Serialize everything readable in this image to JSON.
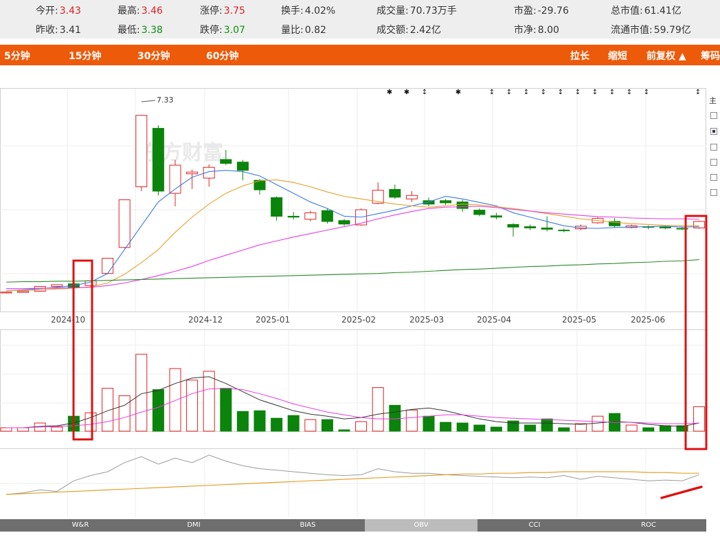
{
  "quote": {
    "row1": [
      {
        "label": "今开:",
        "value": "3.43",
        "color": "red"
      },
      {
        "label": "最高:",
        "value": "3.46",
        "color": "red"
      },
      {
        "label": "涨停:",
        "value": "3.75",
        "color": "red"
      },
      {
        "label": "换手:",
        "value": "4.02%",
        "color": "dark"
      },
      {
        "label": "成交量:",
        "value": "70.73万手",
        "color": "dark"
      },
      {
        "label": "市盈:",
        "value": "-29.76",
        "color": "dark"
      },
      {
        "label": "总市值:",
        "value": "61.41亿",
        "color": "dark"
      }
    ],
    "row2": [
      {
        "label": "昨收:",
        "value": "3.41",
        "color": "dark"
      },
      {
        "label": "最低:",
        "value": "3.38",
        "color": "green"
      },
      {
        "label": "跌停:",
        "value": "3.07",
        "color": "green"
      },
      {
        "label": "量比:",
        "value": "0.82",
        "color": "dark"
      },
      {
        "label": "成交额:",
        "value": "2.42亿",
        "color": "dark"
      },
      {
        "label": "市净:",
        "value": "8.00",
        "color": "dark"
      },
      {
        "label": "流通市值:",
        "value": "59.79亿",
        "color": "dark"
      }
    ]
  },
  "periods": [
    "5分钟",
    "15分钟",
    "30分钟",
    "60分钟"
  ],
  "toolbar": {
    "stretch": "拉长",
    "shrink": "缩短",
    "adjust": "前复权 ▲",
    "chip": "筹码"
  },
  "side_label": "主",
  "watermark": "东方财富",
  "max_price_label": "7.33",
  "x_axis_labels": [
    "2024-10",
    "2024-12",
    "2025-01",
    "2025-02",
    "2025-03",
    "2025-04",
    "2025-05",
    "2025-06"
  ],
  "indicator_tabs": [
    "W&R",
    "DMI",
    "BIAS",
    "OBV",
    "CCI",
    "ROC"
  ],
  "active_tab": "OBV",
  "colors": {
    "up": "#e02020",
    "down": "#0a840a",
    "accent": "#ec5a0a",
    "ma5": "#3b78e7",
    "ma10": "#e3a12c",
    "ma20": "#e83ce0",
    "ma60": "#2a8a2a",
    "highlight": "#dd1111"
  },
  "chart_data": {
    "type": "candlestick",
    "series": [
      {
        "name": "K线",
        "ohlc": [
          [
            2.75,
            2.77,
            2.74,
            2.76
          ],
          [
            2.76,
            2.79,
            2.75,
            2.78
          ],
          [
            2.79,
            2.9,
            2.78,
            2.89
          ],
          [
            2.9,
            2.94,
            2.88,
            2.93
          ],
          [
            2.96,
            2.88,
            2.86,
            2.98
          ],
          [
            2.92,
            3.03,
            2.9,
            3.01
          ],
          [
            3.2,
            3.55,
            3.18,
            3.52
          ],
          [
            3.8,
            4.9,
            3.78,
            4.82
          ],
          [
            5.2,
            6.85,
            5.1,
            6.55
          ],
          [
            6.55,
            5.1,
            5.0,
            6.62
          ],
          [
            5.05,
            5.7,
            4.75,
            5.82
          ],
          [
            5.5,
            5.54,
            5.15,
            5.6
          ],
          [
            5.4,
            5.65,
            5.2,
            5.72
          ],
          [
            5.83,
            5.74,
            5.7,
            6.05
          ],
          [
            5.77,
            5.58,
            5.35,
            5.82
          ],
          [
            5.35,
            5.13,
            5.02,
            5.38
          ],
          [
            4.95,
            4.52,
            4.42,
            4.98
          ],
          [
            4.52,
            4.5,
            4.44,
            4.62
          ],
          [
            4.45,
            4.6,
            4.4,
            4.65
          ],
          [
            4.65,
            4.4,
            4.35,
            4.7
          ],
          [
            4.42,
            4.34,
            4.3,
            4.46
          ],
          [
            4.32,
            4.67,
            4.3,
            4.7
          ],
          [
            4.82,
            5.12,
            4.8,
            5.3
          ],
          [
            5.14,
            4.96,
            4.92,
            5.25
          ],
          [
            4.92,
            5.0,
            4.85,
            5.1
          ],
          [
            4.88,
            4.8,
            4.75,
            4.95
          ],
          [
            4.88,
            4.83,
            4.78,
            4.92
          ],
          [
            4.85,
            4.7,
            4.62,
            4.9
          ],
          [
            4.66,
            4.56,
            4.52,
            4.7
          ],
          [
            4.53,
            4.5,
            4.45,
            4.6
          ],
          [
            4.33,
            4.27,
            4.05,
            4.36
          ],
          [
            4.28,
            4.25,
            4.2,
            4.33
          ],
          [
            4.25,
            4.22,
            4.17,
            4.52
          ],
          [
            4.2,
            4.19,
            4.15,
            4.24
          ],
          [
            4.23,
            4.29,
            4.2,
            4.33
          ],
          [
            4.37,
            4.47,
            4.35,
            4.5
          ],
          [
            4.4,
            4.3,
            4.25,
            4.48
          ],
          [
            4.26,
            4.3,
            4.24,
            4.33
          ],
          [
            4.28,
            4.27,
            4.22,
            4.31
          ],
          [
            4.27,
            4.25,
            4.22,
            4.3
          ],
          [
            4.24,
            4.23,
            4.2,
            4.27
          ],
          [
            4.25,
            4.4,
            4.23,
            4.42
          ]
        ]
      },
      {
        "name": "MA5",
        "values": [
          2.8,
          2.82,
          2.85,
          2.88,
          2.92,
          3.0,
          3.2,
          3.75,
          4.3,
          4.85,
          5.15,
          5.42,
          5.55,
          5.58,
          5.55,
          5.45,
          5.25,
          5.05,
          4.85,
          4.7,
          4.52,
          4.5,
          4.58,
          4.66,
          4.76,
          4.85,
          4.98,
          4.92,
          4.84,
          4.76,
          4.6,
          4.5,
          4.4,
          4.3,
          4.25,
          4.24,
          4.26,
          4.27,
          4.28,
          4.29,
          4.27,
          4.28
        ]
      },
      {
        "name": "MA10",
        "values": [
          2.8,
          2.81,
          2.82,
          2.84,
          2.86,
          2.89,
          2.98,
          3.18,
          3.45,
          3.75,
          4.15,
          4.5,
          4.8,
          5.05,
          5.22,
          5.34,
          5.36,
          5.3,
          5.2,
          5.08,
          4.98,
          4.92,
          4.86,
          4.8,
          4.76,
          4.73,
          4.76,
          4.8,
          4.78,
          4.74,
          4.7,
          4.64,
          4.58,
          4.52,
          4.46,
          4.42,
          4.38,
          4.35,
          4.33,
          4.31,
          4.3,
          4.3
        ]
      },
      {
        "name": "MA20",
        "values": [
          2.85,
          2.85,
          2.86,
          2.86,
          2.87,
          2.88,
          2.92,
          2.98,
          3.06,
          3.15,
          3.25,
          3.36,
          3.5,
          3.62,
          3.74,
          3.86,
          3.95,
          4.04,
          4.12,
          4.2,
          4.28,
          4.36,
          4.46,
          4.55,
          4.63,
          4.7,
          4.73,
          4.74,
          4.75,
          4.72,
          4.68,
          4.64,
          4.6,
          4.57,
          4.54,
          4.51,
          4.5,
          4.48,
          4.47,
          4.46,
          4.46,
          4.45
        ]
      },
      {
        "name": "MA60",
        "values": [
          3.0,
          3.01,
          3.01,
          3.02,
          3.02,
          3.03,
          3.04,
          3.05,
          3.06,
          3.07,
          3.08,
          3.09,
          3.1,
          3.11,
          3.12,
          3.13,
          3.14,
          3.15,
          3.16,
          3.17,
          3.18,
          3.19,
          3.2,
          3.22,
          3.23,
          3.25,
          3.27,
          3.29,
          3.3,
          3.32,
          3.34,
          3.36,
          3.37,
          3.39,
          3.4,
          3.42,
          3.43,
          3.45,
          3.46,
          3.48,
          3.49,
          3.52
        ]
      }
    ],
    "volume": {
      "values": [
        5,
        5,
        12,
        6,
        22,
        27,
        63,
        52,
        113,
        61,
        92,
        75,
        88,
        63,
        29,
        30,
        19,
        23,
        17,
        17,
        2,
        14,
        64,
        38,
        31,
        22,
        13,
        12,
        9,
        6,
        15,
        9,
        18,
        5,
        11,
        22,
        26,
        9,
        5,
        8,
        8,
        36
      ],
      "ma1": [
        5,
        5,
        7,
        8,
        12,
        20,
        30,
        38,
        55,
        60,
        70,
        78,
        80,
        70,
        58,
        46,
        38,
        30,
        25,
        22,
        18,
        20,
        25,
        28,
        32,
        34,
        30,
        24,
        18,
        14,
        12,
        12,
        12,
        11,
        10,
        12,
        14,
        13,
        10,
        8,
        7,
        12
      ],
      "ma2": [
        5,
        5,
        6,
        7,
        8,
        10,
        14,
        20,
        28,
        35,
        45,
        55,
        62,
        63,
        61,
        55,
        48,
        40,
        34,
        28,
        24,
        20,
        18,
        18,
        20,
        22,
        24,
        24,
        22,
        20,
        19,
        18,
        17,
        16,
        15,
        14,
        13,
        13,
        12,
        11,
        11,
        12
      ]
    },
    "indicator": {
      "ma_line": [
        30,
        31,
        32,
        33,
        34,
        35,
        36,
        37,
        38,
        39,
        40,
        41,
        42,
        43,
        44,
        45,
        46,
        47,
        48,
        49,
        50,
        51,
        52,
        53,
        54,
        55,
        56,
        57,
        57,
        58,
        58,
        59,
        59,
        60,
        60,
        60,
        60,
        60,
        59,
        59,
        58,
        58
      ],
      "line": [
        30,
        32,
        36,
        34,
        48,
        55,
        60,
        72,
        80,
        70,
        78,
        72,
        82,
        74,
        68,
        64,
        62,
        60,
        58,
        56,
        55,
        56,
        64,
        60,
        58,
        58,
        56,
        55,
        54,
        53,
        52,
        53,
        52,
        55,
        50,
        54,
        52,
        50,
        48,
        49,
        48,
        56
      ]
    },
    "xlabel": "",
    "ylabel": ""
  }
}
